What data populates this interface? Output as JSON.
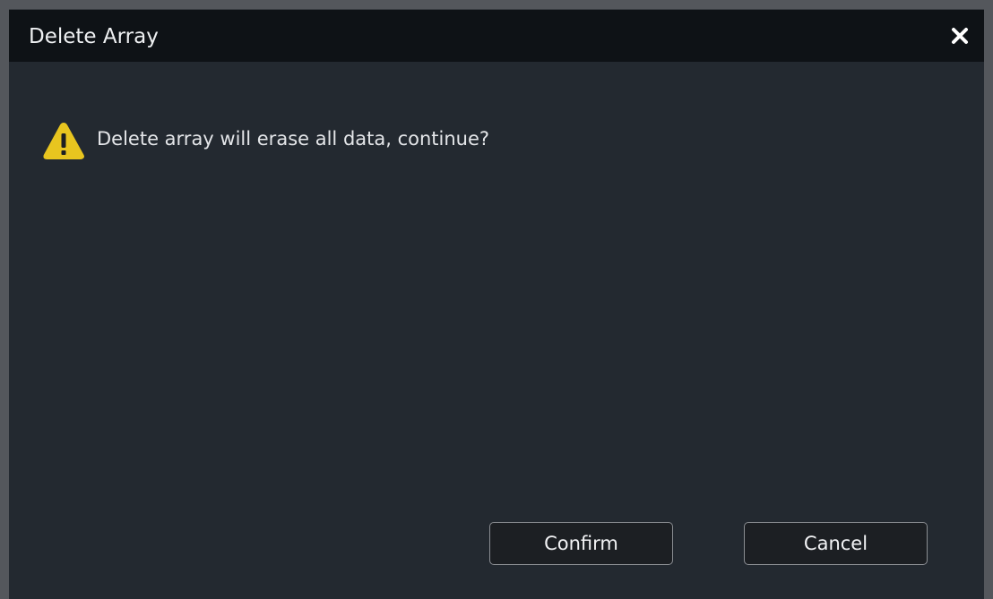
{
  "dialog": {
    "title": "Delete Array",
    "close_icon": "close-icon",
    "message": "Delete array will erase all data, continue?",
    "warning_icon": "warning-triangle-icon",
    "confirm_label": "Confirm",
    "cancel_label": "Cancel"
  },
  "colors": {
    "frame": "#54575c",
    "titlebar": "#0e1216",
    "body": "#232930",
    "warning": "#e8c51f",
    "button_border": "#8a8d92"
  }
}
